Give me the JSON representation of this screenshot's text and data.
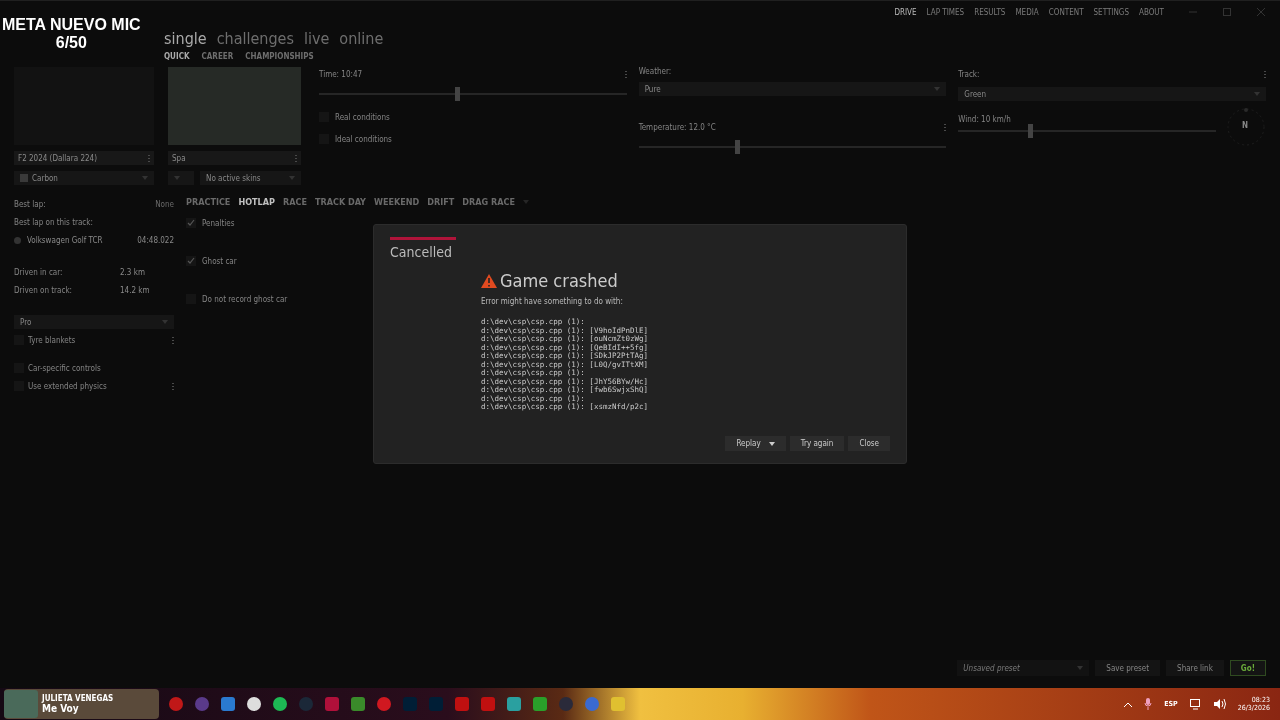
{
  "stream_overlay": {
    "title": "META NUEVO MIC",
    "count": "6/50"
  },
  "header": {
    "sections": [
      {
        "label": "single",
        "selected": true
      },
      {
        "label": "challenges",
        "selected": false
      },
      {
        "label": "live",
        "selected": false
      },
      {
        "label": "online",
        "selected": false
      }
    ],
    "subtabs": [
      {
        "label": "QUICK",
        "selected": true
      },
      {
        "label": "CAREER",
        "selected": false
      },
      {
        "label": "CHAMPIONSHIPS",
        "selected": false
      }
    ],
    "nav": [
      {
        "label": "DRIVE",
        "selected": true
      },
      {
        "label": "LAP TIMES",
        "selected": false
      },
      {
        "label": "RESULTS",
        "selected": false
      },
      {
        "label": "MEDIA",
        "selected": false
      },
      {
        "label": "CONTENT",
        "selected": false
      },
      {
        "label": "SETTINGS",
        "selected": false
      },
      {
        "label": "ABOUT",
        "selected": false
      }
    ]
  },
  "car": {
    "name": "F2 2024 (Dallara 224)",
    "skin": "Carbon"
  },
  "track": {
    "name": "Spa",
    "skins": "No active skins"
  },
  "stats": {
    "best_lap_label": "Best lap:",
    "best_lap": "None",
    "best_on_track_label": "Best lap on this track:",
    "best_on_track_car": "Volkswagen Golf TCR",
    "best_on_track_time": "04:48.022",
    "rows": [
      {
        "label": "Driven in car:",
        "value": "2.3 km"
      },
      {
        "label": "Driven on track:",
        "value": "14.2 km"
      }
    ]
  },
  "assists": {
    "preset": "Pro",
    "options": [
      {
        "label": "Tyre blankets",
        "checked": false,
        "menu": true
      },
      {
        "label": "Car-specific controls",
        "checked": false,
        "menu": false
      },
      {
        "label": "Use extended physics",
        "checked": false,
        "menu": true
      }
    ]
  },
  "modes": [
    {
      "label": "PRACTICE",
      "selected": false
    },
    {
      "label": "HOTLAP",
      "selected": true
    },
    {
      "label": "RACE",
      "selected": false
    },
    {
      "label": "TRACK DAY",
      "selected": false
    },
    {
      "label": "WEEKEND",
      "selected": false
    },
    {
      "label": "DRIFT",
      "selected": false
    },
    {
      "label": "DRAG RACE",
      "selected": false
    }
  ],
  "mode_options": [
    {
      "label": "Penalties",
      "checked": true
    },
    {
      "label": "Ghost car",
      "checked": true
    },
    {
      "label": "Do not record ghost car",
      "checked": false
    }
  ],
  "conditions": {
    "time": {
      "label": "Time: 10:47",
      "level": 0.45
    },
    "toggles": [
      {
        "label": "Real conditions",
        "checked": false
      },
      {
        "label": "Ideal conditions",
        "checked": false
      }
    ],
    "weather": {
      "label": "Weather:",
      "value": "Pure"
    },
    "temperature": {
      "label": "Temperature: 12.0 °C",
      "level": 0.32
    },
    "track_state": {
      "label": "Track:",
      "value": "Green"
    },
    "wind": {
      "label": "Wind: 10 km/h",
      "level": 0.28,
      "compass": "N"
    }
  },
  "dialog": {
    "header": "Cancelled",
    "title": "Game crashed",
    "message": "Error might have something to do with:",
    "log": [
      "d:\\dev\\csp\\csp.cpp (1):",
      "d:\\dev\\csp\\csp.cpp (1): [V9hoIdPnDlE]",
      "d:\\dev\\csp\\csp.cpp (1): [ouNcmZt0zWg]",
      "d:\\dev\\csp\\csp.cpp (1): [QeBIdI++5fg]",
      "d:\\dev\\csp\\csp.cpp (1): [SDkJP2PtTAg]",
      "d:\\dev\\csp\\csp.cpp (1): [L0Q/gvITtXM]",
      "d:\\dev\\csp\\csp.cpp (1):",
      "d:\\dev\\csp\\csp.cpp (1): [JhY56BYw/Hc]",
      "d:\\dev\\csp\\csp.cpp (1): [fwb6SwjxShQ]",
      "d:\\dev\\csp\\csp.cpp (1):",
      "d:\\dev\\csp\\csp.cpp (1): [xsmzNfd/p2c]"
    ],
    "buttons": [
      {
        "label": "Replay",
        "kind": "split"
      },
      {
        "label": "Try again",
        "kind": "plain"
      },
      {
        "label": "Close",
        "kind": "plain"
      }
    ]
  },
  "footer": {
    "preset_placeholder": "Unsaved preset",
    "buttons": [
      {
        "label": "Save preset",
        "kind": "plain"
      },
      {
        "label": "Share link",
        "kind": "plain"
      },
      {
        "label": "Go!",
        "kind": "primary"
      }
    ]
  },
  "taskbar": {
    "now_playing": {
      "artist": "JULIETA VENEGAS",
      "song": "Me Voy"
    },
    "language": "ESP",
    "time": "08:23",
    "date": "26/3/2026"
  }
}
